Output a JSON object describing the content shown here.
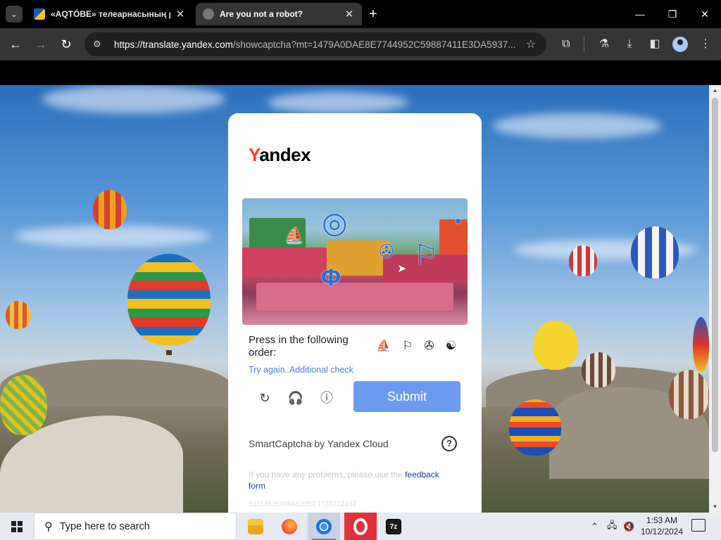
{
  "browser": {
    "tabs": [
      {
        "title": "«AQTÓBE» телеарнасының р",
        "close": "✕"
      },
      {
        "title": "Are you not a robot?",
        "close": "✕"
      }
    ],
    "new_tab": "+",
    "url": {
      "host": "https://translate.yandex.com",
      "rest": "/showcaptcha?mt=1479A0DAE8E7744952C59887411E3DA5937..."
    }
  },
  "captcha": {
    "logo": {
      "first": "Y",
      "rest": "andex"
    },
    "instruction": "Press in the following order:",
    "order_icons": [
      "ship-glyph",
      "flag-glyph",
      "planet-glyph",
      "spiral-glyph"
    ],
    "order_symbols": [
      "⛵",
      "⚐",
      "✇",
      "☯"
    ],
    "try_again": "Try again. Additional check",
    "submit_label": "Submit",
    "brand_line": "SmartCaptcha by Yandex Cloud",
    "help_symbol": "?",
    "problems_text": "If you have any problems, please use the ",
    "feedback_link": "feedback form",
    "request_id": "53314536606682050 1728712432"
  },
  "taskbar": {
    "search_placeholder": "Type here to search",
    "time": "1:53 AM",
    "date": "10/12/2024"
  },
  "colors": {
    "chrome_bg": "#000000",
    "toolbar_bg": "#353535",
    "submit_bg": "#6a9bf0",
    "yandex_red": "#fc3f1d",
    "link_blue": "#4a7fd4"
  }
}
